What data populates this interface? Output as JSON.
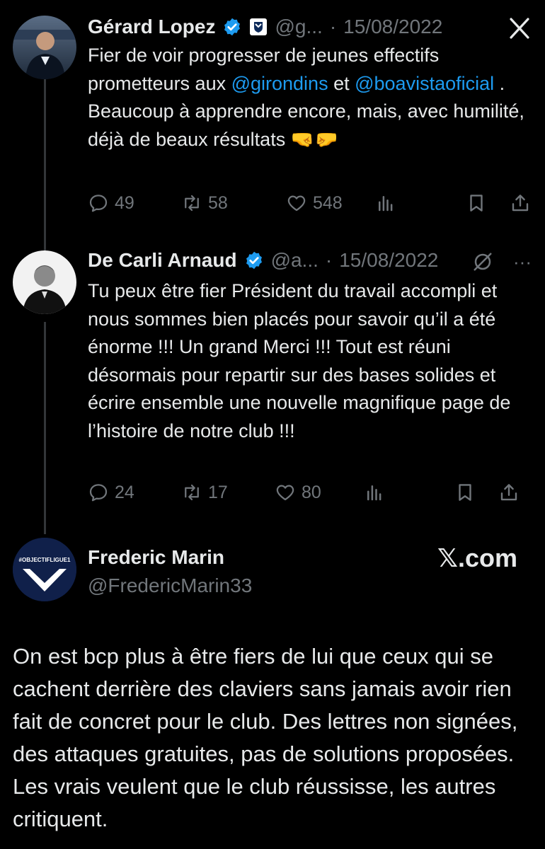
{
  "tweet1": {
    "name": "Gérard Lopez",
    "handle": "@g...",
    "sep": "·",
    "date": "15/08/2022",
    "text_a": "Fier de voir progresser de jeunes effectifs prometteurs aux ",
    "mention1": "@girondins",
    "text_b": " et ",
    "mention2": "@boavistaoficial",
    "text_c": " . Beaucoup à apprendre encore, mais, avec humilité, déjà de beaux résultats 🤜🤛",
    "replies": "49",
    "retweets": "58",
    "likes": "548"
  },
  "tweet2": {
    "name": "De Carli Arnaud",
    "handle": "@a...",
    "sep": "·",
    "date": "15/08/2022",
    "more": "···",
    "text": "Tu peux être fier Président du travail accompli et nous sommes bien placés pour savoir qu’il a été énorme !!! Un grand Merci !!! Tout est réuni désormais pour repartir sur des bases solides et écrire ensemble une nouvelle magnifique page de l’histoire de notre club !!!",
    "replies": "24",
    "retweets": "17",
    "likes": "80"
  },
  "tweet3": {
    "name": "Frederic Marin",
    "handle": "@FredericMarin33",
    "avatar_text": "#OBJECTIFLIGUE1",
    "brand": "𝕏.com",
    "text": "On est bcp plus à être fiers de lui que ceux qui se cachent derrière des claviers sans jamais avoir rien fait de concret pour le club. Des lettres non signées, des attaques gratuites, pas de solutions proposées. Les vrais veulent que le club réussisse, les autres critiquent."
  },
  "close_label": "X",
  "colors": {
    "background": "#000000",
    "text": "#e7e9ea",
    "muted": "#71767b",
    "link": "#1d9bf0",
    "verified": "#1d9bf0"
  }
}
